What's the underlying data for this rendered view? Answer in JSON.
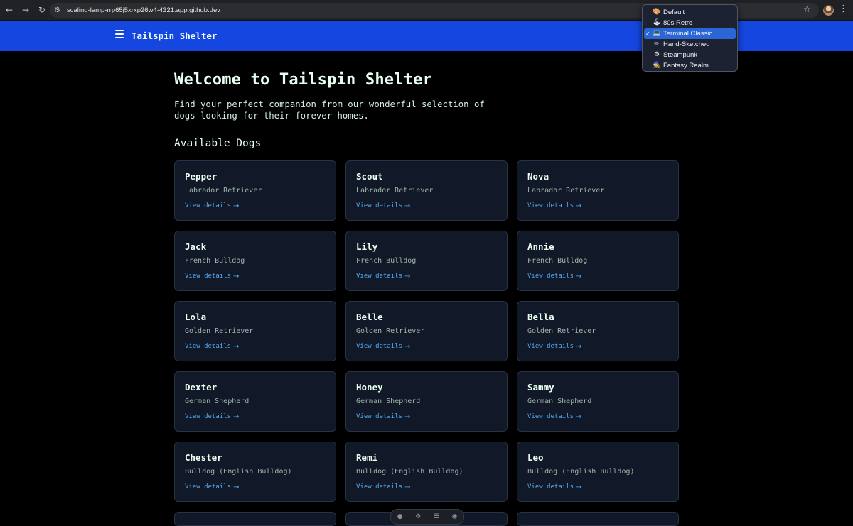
{
  "browser": {
    "url": "scaling-lamp-rrp65j5xrxp26w4-4321.app.github.dev"
  },
  "header": {
    "brand": "Tailspin Shelter"
  },
  "hero": {
    "title": "Welcome to Tailspin Shelter",
    "subtitle": "Find your perfect companion from our wonderful selection of dogs looking for their forever homes."
  },
  "section": {
    "title": "Available Dogs"
  },
  "link_label": "View details",
  "dogs": [
    {
      "name": "Pepper",
      "breed": "Labrador Retriever"
    },
    {
      "name": "Scout",
      "breed": "Labrador Retriever"
    },
    {
      "name": "Nova",
      "breed": "Labrador Retriever"
    },
    {
      "name": "Jack",
      "breed": "French Bulldog"
    },
    {
      "name": "Lily",
      "breed": "French Bulldog"
    },
    {
      "name": "Annie",
      "breed": "French Bulldog"
    },
    {
      "name": "Lola",
      "breed": "Golden Retriever"
    },
    {
      "name": "Belle",
      "breed": "Golden Retriever"
    },
    {
      "name": "Bella",
      "breed": "Golden Retriever"
    },
    {
      "name": "Dexter",
      "breed": "German Shepherd"
    },
    {
      "name": "Honey",
      "breed": "German Shepherd"
    },
    {
      "name": "Sammy",
      "breed": "German Shepherd"
    },
    {
      "name": "Chester",
      "breed": "Bulldog (English Bulldog)"
    },
    {
      "name": "Remi",
      "breed": "Bulldog (English Bulldog)"
    },
    {
      "name": "Leo",
      "breed": "Bulldog (English Bulldog)"
    }
  ],
  "theme_menu": {
    "selected": "Terminal Classic",
    "items": [
      {
        "label": "Default",
        "icon": "palette-icon"
      },
      {
        "label": "80s Retro",
        "icon": "joystick-icon"
      },
      {
        "label": "Terminal Classic",
        "icon": "computer-icon"
      },
      {
        "label": "Hand-Sketched",
        "icon": "pencil-icon"
      },
      {
        "label": "Steampunk",
        "icon": "gear-icon"
      },
      {
        "label": "Fantasy Realm",
        "icon": "wizard-icon"
      }
    ]
  },
  "colors": {
    "header_bg": "#1547e0",
    "page_bg": "#000000",
    "card_bg": "#111827",
    "card_border": "#273245",
    "link": "#52a8ee",
    "menu_selected": "#2a66d6"
  }
}
